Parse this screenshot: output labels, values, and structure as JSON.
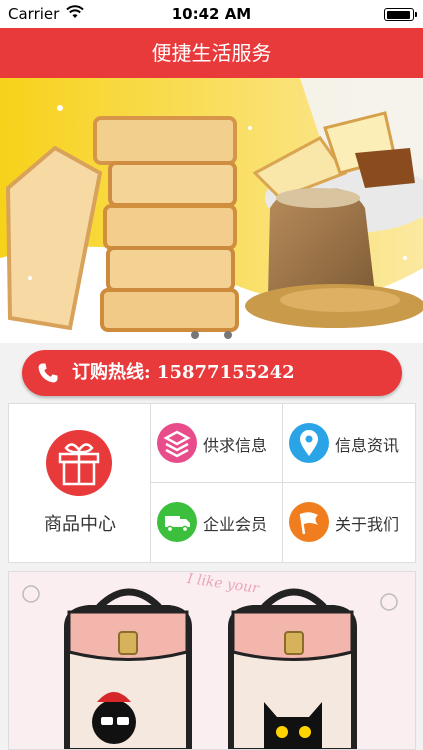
{
  "status_bar": {
    "carrier": "Carrier",
    "time": "10:42 AM"
  },
  "nav": {
    "title": "便捷生活服务"
  },
  "banner": {
    "image": "bread-and-wheat-sack-photo",
    "page_count": 2,
    "active_page": 1
  },
  "hotline": {
    "prefix": "订购热线: ",
    "number": "15877155242",
    "icon": "phone-icon"
  },
  "grid": {
    "product_center": {
      "label": "商品中心",
      "icon": "gift-icon"
    },
    "supply_demand": {
      "label": "供求信息",
      "icon": "layers-icon"
    },
    "news": {
      "label": "信息资讯",
      "icon": "location-pin-icon"
    },
    "member": {
      "label": "企业会员",
      "icon": "truck-icon"
    },
    "about": {
      "label": "关于我们",
      "icon": "flag-icon"
    }
  },
  "product_banner": {
    "image": "pink-cartoon-backpacks-photo",
    "decor_text": "I like your"
  },
  "colors": {
    "brand_red": "#e8393b",
    "pink": "#e84c8a",
    "blue": "#2aa4e6",
    "green": "#3cbf3c",
    "orange": "#f07e1e"
  }
}
